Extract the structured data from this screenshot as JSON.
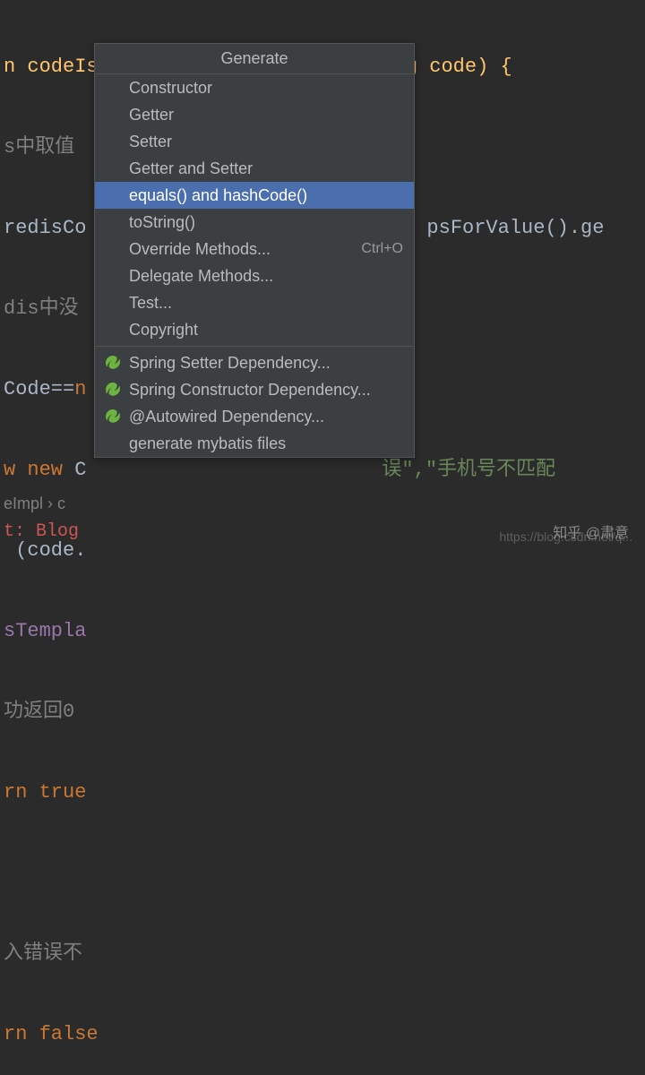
{
  "code": {
    "l0a": "n codeIsRight(String mobile, String code) {",
    "l1": "s中取值",
    "l2a": "redisCo",
    "l2b": "psForValue().ge",
    "l3": "dis中没",
    "l4a": "Code==",
    "l4b": "n",
    "l5a": "w new ",
    "l5b": "C",
    "l5c": "误\",\"手机号不匹配",
    "l6a": " (code.",
    "l7": "sTempla",
    "l8": "功返回0",
    "l9a": "rn tru",
    "l9b": "e",
    "l10": "",
    "l11": "入错误不",
    "l12a": "rn fals",
    "l12b": "e"
  },
  "popup": {
    "title": "Generate",
    "items": [
      {
        "label": "Constructor",
        "icon": "",
        "shortcut": "",
        "selected": false
      },
      {
        "label": "Getter",
        "icon": "",
        "shortcut": "",
        "selected": false
      },
      {
        "label": "Setter",
        "icon": "",
        "shortcut": "",
        "selected": false
      },
      {
        "label": "Getter and Setter",
        "icon": "",
        "shortcut": "",
        "selected": false
      },
      {
        "label": "equals() and hashCode()",
        "icon": "",
        "shortcut": "",
        "selected": true
      },
      {
        "label": "toString()",
        "icon": "",
        "shortcut": "",
        "selected": false
      },
      {
        "label": "Override Methods...",
        "icon": "",
        "shortcut": "Ctrl+O",
        "selected": false
      },
      {
        "label": "Delegate Methods...",
        "icon": "",
        "shortcut": "",
        "selected": false
      },
      {
        "label": "Test...",
        "icon": "",
        "shortcut": "",
        "selected": false
      },
      {
        "label": "Copyright",
        "icon": "",
        "shortcut": "",
        "selected": false
      }
    ],
    "sep": true,
    "items2": [
      {
        "label": "Spring Setter Dependency...",
        "icon": "spring",
        "shortcut": "",
        "selected": false
      },
      {
        "label": "Spring Constructor Dependency...",
        "icon": "spring",
        "shortcut": "",
        "selected": false
      },
      {
        "label": "@Autowired Dependency...",
        "icon": "spring",
        "shortcut": "",
        "selected": false
      },
      {
        "label": "generate mybatis files",
        "icon": "",
        "shortcut": "",
        "selected": false
      }
    ]
  },
  "breadcrumb": {
    "a": "eImpl",
    "b": "c"
  },
  "blog": {
    "prefix": "t: ",
    "name": "Blog"
  },
  "watermark": "知乎 @肃意",
  "watermark2": "https://blog.csdn.net/q..."
}
